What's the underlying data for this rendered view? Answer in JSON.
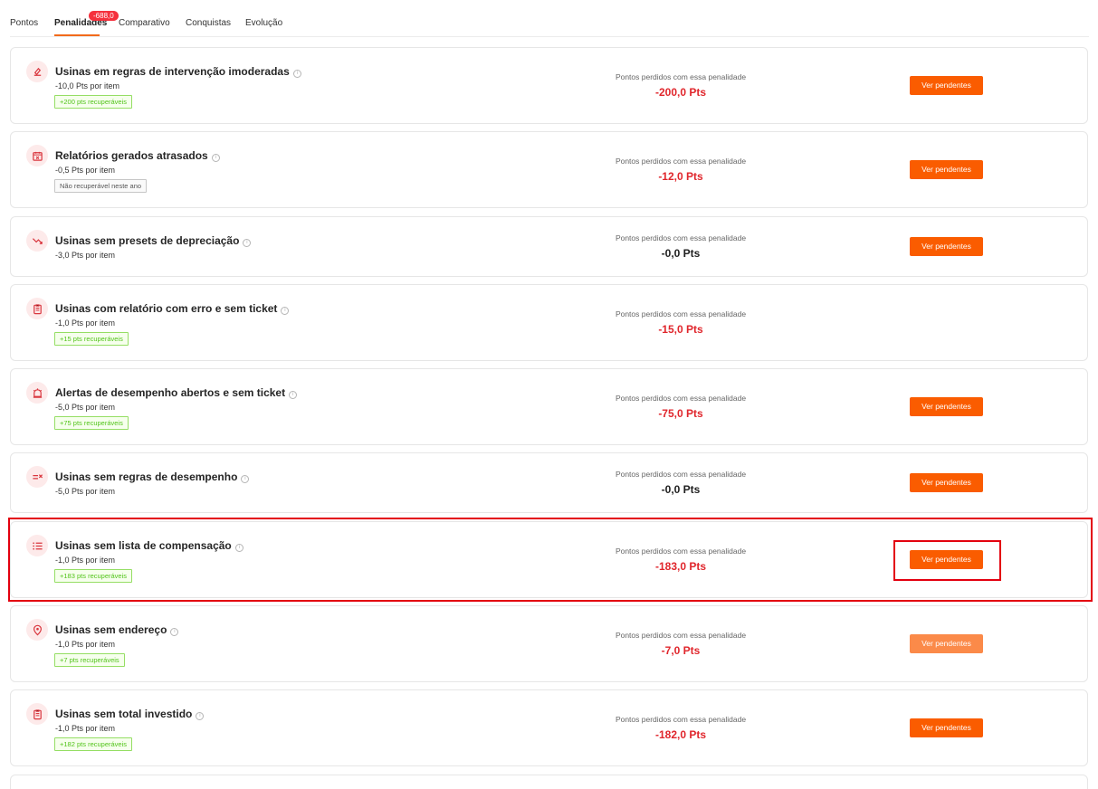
{
  "tabs": [
    {
      "label": "Pontos"
    },
    {
      "label": "Penalidades",
      "active": true,
      "badge": "-688,0"
    },
    {
      "label": "Comparativo"
    },
    {
      "label": "Conquistas"
    },
    {
      "label": "Evolução"
    }
  ],
  "lost_label": "Pontos perdidos com essa penalidade",
  "button_label": "Ver pendentes",
  "info_glyph": "i",
  "colors": {
    "accent": "#fa5c00",
    "penalty_red": "#e0262c",
    "badge_red": "#f5313d",
    "tag_green": "#52c41a",
    "highlight": "#e3000f"
  },
  "penalties": [
    {
      "icon": "rules-icon",
      "title": "Usinas em regras de intervenção imoderadas",
      "per_item": "-10,0 Pts por item",
      "tag": "+200 pts recuperáveis",
      "tag_type": "green",
      "value": "-200,0 Pts",
      "value_color": "red",
      "button": true
    },
    {
      "icon": "calendar-x-icon",
      "title": "Relatórios gerados atrasados",
      "per_item": "-0,5 Pts por item",
      "tag": "Não recuperável neste ano",
      "tag_type": "gray",
      "value": "-12,0 Pts",
      "value_color": "red",
      "button": true
    },
    {
      "icon": "trend-down-icon",
      "title": "Usinas sem presets de depreciação",
      "per_item": "-3,0 Pts por item",
      "value": "-0,0 Pts",
      "value_color": "black",
      "button": true
    },
    {
      "icon": "clipboard-icon",
      "title": "Usinas com relatório com erro e sem ticket",
      "per_item": "-1,0 Pts por item",
      "tag": "+15 pts recuperáveis",
      "tag_type": "green",
      "value": "-15,0 Pts",
      "value_color": "red",
      "button": false
    },
    {
      "icon": "alarm-icon",
      "title": "Alertas de desempenho abertos e sem ticket",
      "per_item": "-5,0 Pts por item",
      "tag": "+75 pts recuperáveis",
      "tag_type": "green",
      "value": "-75,0 Pts",
      "value_color": "red",
      "button": true
    },
    {
      "icon": "list-x-icon",
      "title": "Usinas sem regras de desempenho",
      "per_item": "-5,0 Pts por item",
      "value": "-0,0 Pts",
      "value_color": "black",
      "button": true
    },
    {
      "icon": "list-icon",
      "title": "Usinas sem lista de compensação",
      "per_item": "-1,0 Pts por item",
      "tag": "+183 pts recuperáveis",
      "tag_type": "green",
      "value": "-183,0 Pts",
      "value_color": "red",
      "button": true,
      "highlighted": true
    },
    {
      "icon": "location-pin-icon",
      "title": "Usinas sem endereço",
      "per_item": "-1,0 Pts por item",
      "tag": "+7 pts recuperáveis",
      "tag_type": "green",
      "value": "-7,0 Pts",
      "value_color": "red",
      "button": true,
      "button_state": "hover"
    },
    {
      "icon": "clipboard-icon",
      "title": "Usinas sem total investido",
      "per_item": "-1,0 Pts por item",
      "tag": "+182 pts recuperáveis",
      "tag_type": "green",
      "value": "-182,0 Pts",
      "value_color": "red",
      "button": true
    }
  ]
}
